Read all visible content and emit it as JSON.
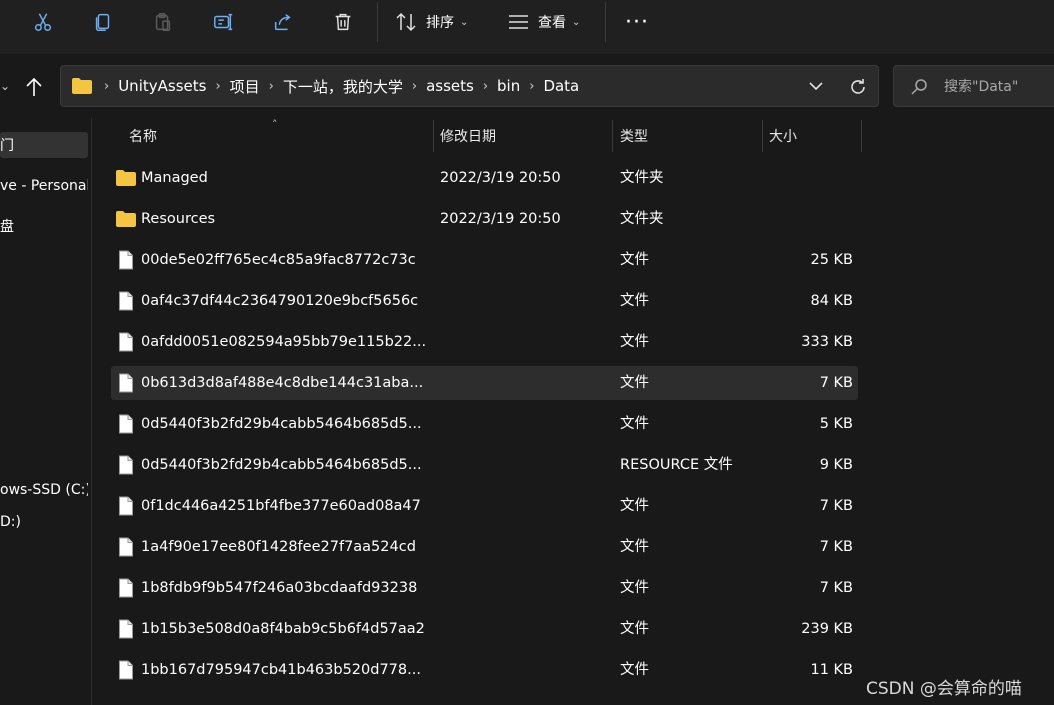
{
  "toolbar": {
    "sort_label": "排序",
    "view_label": "查看",
    "icons": [
      "cut-icon",
      "copy-icon",
      "paste-icon",
      "rename-icon",
      "share-icon",
      "delete-icon",
      "sort-icon",
      "view-icon",
      "more-icon"
    ]
  },
  "address": {
    "crumbs": [
      "UnityAssets",
      "项目",
      "下一站，我的大学",
      "assets",
      "bin",
      "Data"
    ]
  },
  "search": {
    "placeholder": "搜索\"Data\""
  },
  "sidebar": {
    "items": [
      {
        "label": "门"
      },
      {
        "label": "ve - Personal"
      },
      {
        "label": "盘"
      },
      {
        "label": "ows-SSD (C:)"
      },
      {
        "label": "D:)"
      }
    ]
  },
  "columns": {
    "name": "名称",
    "date": "修改日期",
    "type": "类型",
    "size": "大小"
  },
  "files": [
    {
      "name": "Managed",
      "date": "2022/3/19 20:50",
      "type": "文件夹",
      "size": "",
      "kind": "folder"
    },
    {
      "name": "Resources",
      "date": "2022/3/19 20:50",
      "type": "文件夹",
      "size": "",
      "kind": "folder"
    },
    {
      "name": "00de5e02ff765ec4c85a9fac8772c73c",
      "date": "",
      "type": "文件",
      "size": "25 KB",
      "kind": "file"
    },
    {
      "name": "0af4c37df44c2364790120e9bcf5656c",
      "date": "",
      "type": "文件",
      "size": "84 KB",
      "kind": "file"
    },
    {
      "name": "0afdd0051e082594a95bb79e115b22...",
      "date": "",
      "type": "文件",
      "size": "333 KB",
      "kind": "file"
    },
    {
      "name": "0b613d3d8af488e4c8dbe144c31aba...",
      "date": "",
      "type": "文件",
      "size": "7 KB",
      "kind": "file"
    },
    {
      "name": "0d5440f3b2fd29b4cabb5464b685d5...",
      "date": "",
      "type": "文件",
      "size": "5 KB",
      "kind": "file"
    },
    {
      "name": "0d5440f3b2fd29b4cabb5464b685d5...",
      "date": "",
      "type": "RESOURCE 文件",
      "size": "9 KB",
      "kind": "file"
    },
    {
      "name": "0f1dc446a4251bf4fbe377e60ad08a47",
      "date": "",
      "type": "文件",
      "size": "7 KB",
      "kind": "file"
    },
    {
      "name": "1a4f90e17ee80f1428fee27f7aa524cd",
      "date": "",
      "type": "文件",
      "size": "7 KB",
      "kind": "file"
    },
    {
      "name": "1b8fdb9f9b547f246a03bcdaafd93238",
      "date": "",
      "type": "文件",
      "size": "7 KB",
      "kind": "file"
    },
    {
      "name": "1b15b3e508d0a8f4bab9c5b6f4d57aa2",
      "date": "",
      "type": "文件",
      "size": "239 KB",
      "kind": "file"
    },
    {
      "name": "1bb167d795947cb41b463b520d778...",
      "date": "",
      "type": "文件",
      "size": "11 KB",
      "kind": "file"
    }
  ],
  "hovered_row": 5,
  "watermark": "CSDN @会算命的喵",
  "colors": {
    "background": "#191919",
    "toolbar": "#202020",
    "folder": "#f4c542",
    "hover_row": "#2d2d2d",
    "share_blue": "#6ab0f3"
  }
}
